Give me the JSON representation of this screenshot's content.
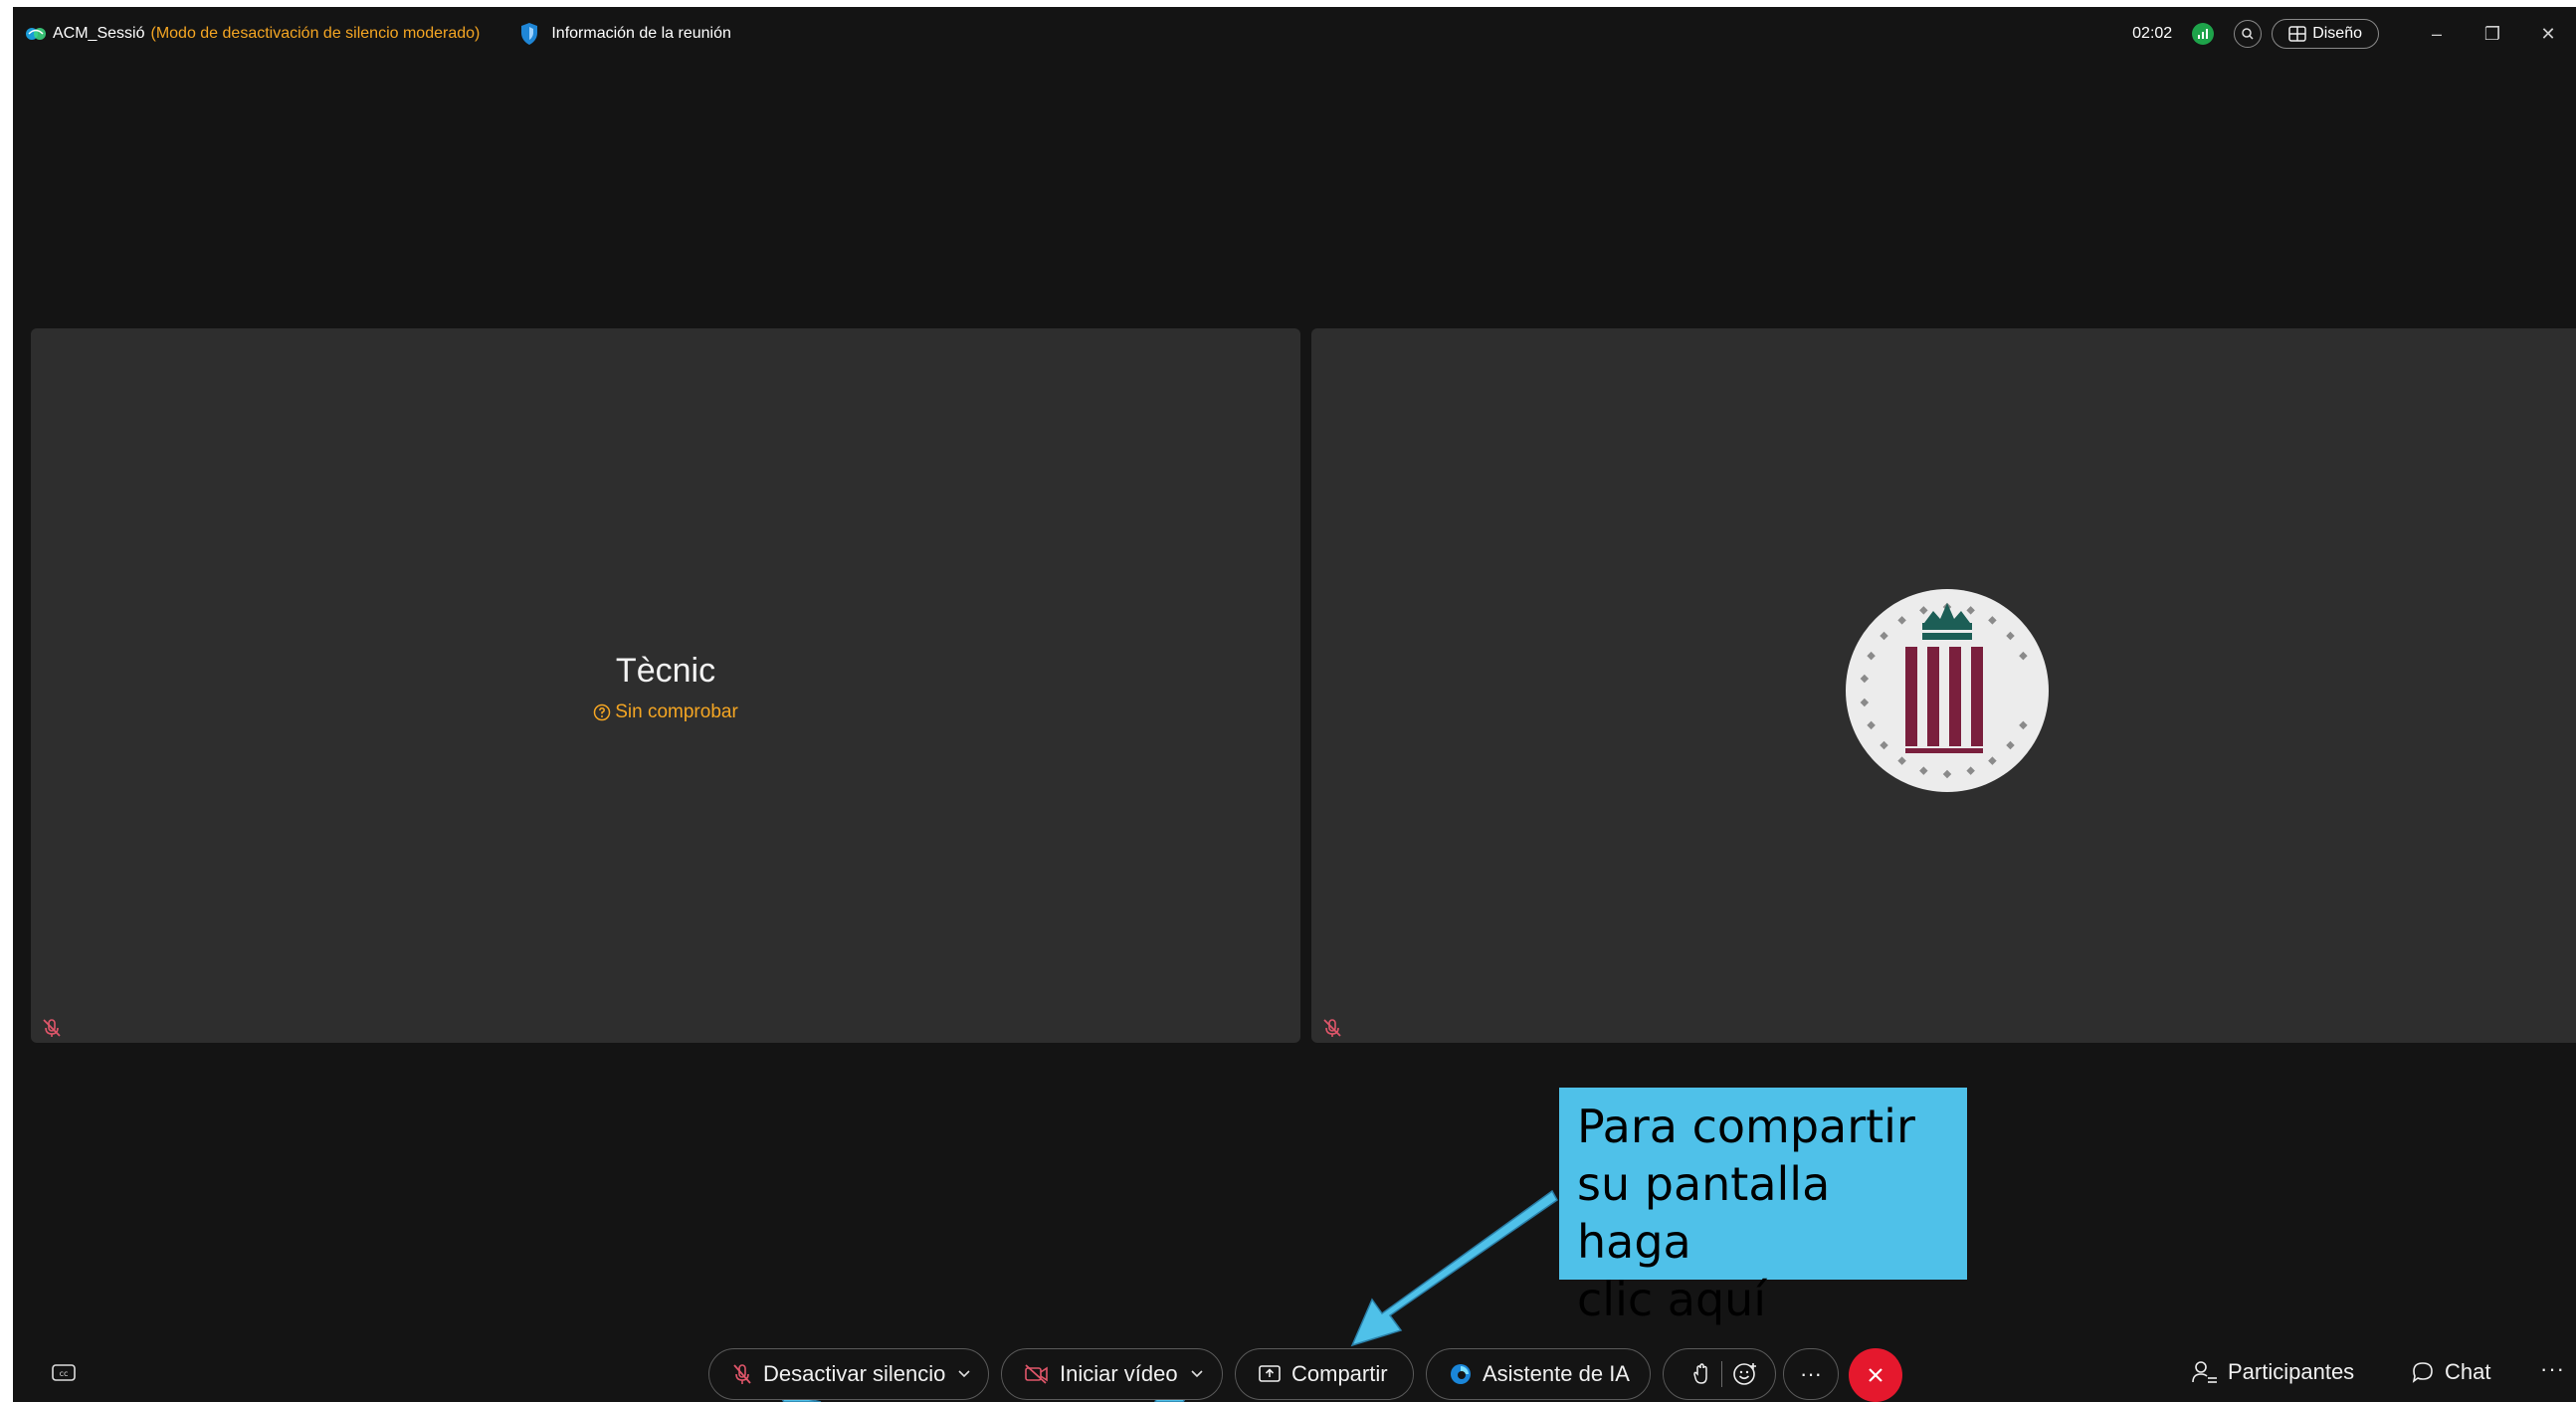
{
  "titlebar": {
    "meeting_name": "ACM_Sessió",
    "mute_mode": "(Modo de desactivación de silencio moderado)",
    "info_label": "Información de la reunión",
    "timer": "02:02",
    "layout_label": "Diseño",
    "minimize_glyph": "–",
    "restore_glyph": "❐",
    "close_glyph": "✕"
  },
  "tiles": [
    {
      "name": "Tècnic",
      "status": "Sin comprobar"
    },
    {
      "name": "",
      "status": ""
    }
  ],
  "callout": {
    "text": "Para compartir\nsu pantalla haga\nclic aquí"
  },
  "toolbar": {
    "mute_label": "Desactivar silencio",
    "video_label": "Iniciar vídeo",
    "share_label": "Compartir",
    "ai_label": "Asistente de IA",
    "more_glyph": "···",
    "participants_label": "Participantes",
    "chat_label": "Chat",
    "overflow_glyph": "···"
  },
  "colors": {
    "background": "#141414",
    "tile": "#2e2e2e",
    "warning": "#f5a623",
    "leave": "#e5182d",
    "callout": "#4fc1e9",
    "muted_icon": "#e0566a"
  }
}
